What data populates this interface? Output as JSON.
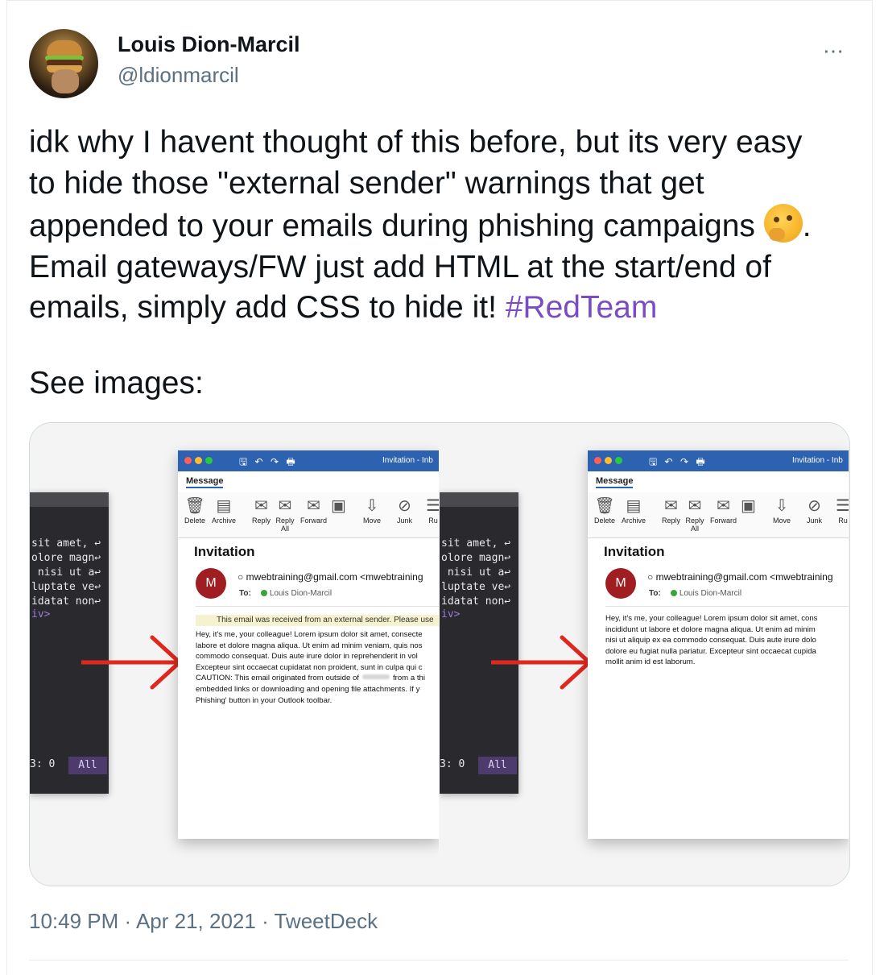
{
  "author": {
    "name": "Louis Dion-Marcil",
    "handle": "@ldionmarcil",
    "more_icon": "⋯"
  },
  "tweet": {
    "text_lines": [
      "idk why I havent thought of this before, but its very easy",
      "to hide those \"external sender\" warnings that get",
      "appended to your emails during phishing campaigns",
      "Email gateways/FW just add HTML at the start/end of",
      "emails, simply add CSS to hide it!"
    ],
    "emoji_name": "thinking-face-emoji",
    "after_emoji": ".",
    "hashtag": "#RedTeam",
    "see_images": "See images:"
  },
  "screenshot": {
    "terminal": {
      "lines": [
        "sit amet, ↩",
        "olore magn↩",
        " nisi ut a↩",
        "luptate ve↩",
        "idatat non↩",
        "iv>"
      ],
      "status_left": "3: 0",
      "status_right": "All"
    },
    "outlook": {
      "window_title": "Invitation - Inb",
      "quick_access": "🖫 ↶ ↷ 🖶",
      "ribbon_tab": "Message",
      "ribbon_buttons": [
        {
          "label": "Delete",
          "icon": "🗑"
        },
        {
          "label": "Archive",
          "icon": "▤"
        },
        {
          "label": "Reply",
          "icon": "✉"
        },
        {
          "label": "Reply All",
          "icon": "✉"
        },
        {
          "label": "Forward",
          "icon": "✉"
        },
        {
          "label": "",
          "icon": "▣"
        },
        {
          "label": "Move",
          "icon": "⇩"
        },
        {
          "label": "Junk",
          "icon": "⊘"
        },
        {
          "label": "Ru",
          "icon": "☰"
        }
      ],
      "subject": "Invitation",
      "avatar_letter": "M",
      "from": "○ mwebtraining@gmail.com <mwebtraining",
      "to_label": "To:",
      "to_name": "Louis Dion-Marcil",
      "warning_banner": "This email was received from an external sender. Please use",
      "left_body_lines": [
        "Hey, it's me, your colleague! Lorem ipsum dolor sit amet, consecte",
        "labore et dolore magna aliqua. Ut enim ad minim veniam, quis nos",
        "commodo consequat. Duis aute irure dolor in reprehenderit in vol",
        "Excepteur sint occaecat cupidatat non proident, sunt in culpa qui c",
        "CAUTION: This email originated from outside of",
        "from a thi",
        "embedded links or downloading and opening file attachments. If y",
        "Phishing' button in your Outlook toolbar."
      ],
      "right_body_lines": [
        "Hey, it's me, your colleague! Lorem ipsum dolor sit amet, cons",
        "incididunt ut labore et dolore magna aliqua. Ut enim ad minim",
        "nisi ut aliquip ex ea commodo consequat. Duis aute irure dolo",
        "dolore eu fugiat nulla pariatur. Excepteur sint occaecat cupida",
        "mollit anim id est laborum."
      ]
    },
    "arrow_color": "#e0281e"
  },
  "footer": {
    "timestamp": "10:49 PM · Apr 21, 2021 · TweetDeck"
  },
  "colors": {
    "hashtag": "#794bc4",
    "secondary_text": "#5b7083",
    "outlook_blue": "#2d62b0"
  }
}
